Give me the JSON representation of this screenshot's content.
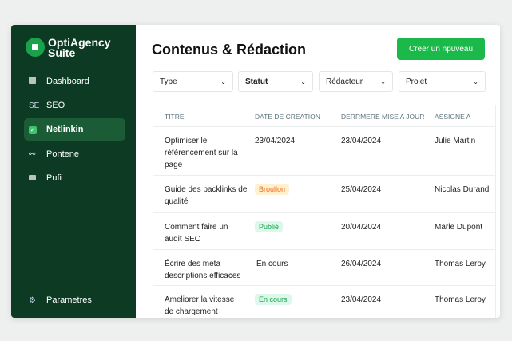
{
  "sidebar": {
    "brand": "OptiAgency Suite",
    "items": [
      {
        "label": "Dashboard",
        "icon": "dashboard-icon"
      },
      {
        "label": "SEO",
        "icon_text": "SE"
      },
      {
        "label": "Netlinkin",
        "icon": "check-icon",
        "active": true
      },
      {
        "label": "Pontene",
        "icon": "link-icon"
      },
      {
        "label": "Pufi",
        "icon": "card-icon"
      }
    ],
    "settings": "Parametres"
  },
  "header": {
    "title": "Contenus & Rédaction",
    "new_button": "Creer un npuveau"
  },
  "filters": [
    "Type",
    "Statut",
    "Rédacteur",
    "Projet"
  ],
  "table": {
    "headers": [
      "TITRE",
      "DATE DE CREATION",
      "DERRMERE MISE A JOUR",
      "ASSIGNE A"
    ],
    "rows": [
      {
        "title": "Optimiser le référencement sur la page",
        "created": "23/04/2024",
        "updated": "23/04/2024",
        "assignee": "Julie Martin"
      },
      {
        "title": "Guide des backlinks de qualité",
        "created": "Broullon",
        "updated": "25/04/2024",
        "assignee": "Nicolas Durand"
      },
      {
        "title": "Comment faire un audit SEO",
        "created": "Publié",
        "updated": "20/04/2024",
        "assignee": "Marle Dupont"
      },
      {
        "title": "Écrire des meta descriptions efficaces",
        "created": "En cours",
        "updated": "26/04/2024",
        "assignee": "Thomas Leroy"
      },
      {
        "title": "Ameliorer la vitesse de chargement",
        "created": "En cours",
        "updated": "23/04/2024",
        "assignee": "Thomas Leroy"
      }
    ]
  },
  "colors": {
    "sidebar": "#0c3a22",
    "accent": "#1bb94a",
    "draft": "#f06a1d",
    "published": "#1aa34a"
  }
}
